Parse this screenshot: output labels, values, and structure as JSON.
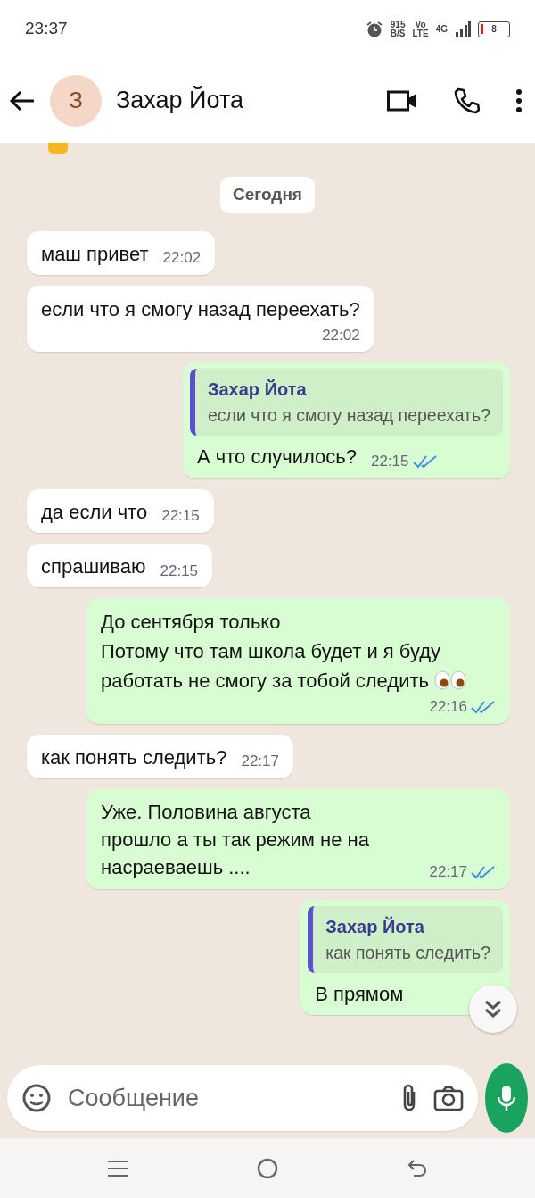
{
  "status_bar": {
    "time": "23:37",
    "speed": "915",
    "speed_unit": "B/S",
    "volte_top": "Vo",
    "volte_bottom": "LTE",
    "network": "4G",
    "battery": "8"
  },
  "header": {
    "avatar_letter": "З",
    "contact_name": "Захар Йота"
  },
  "date_chip": "Сегодня",
  "messages": [
    {
      "kind": "in",
      "text": "маш привет",
      "time": "22:02"
    },
    {
      "kind": "in",
      "text": "если что я смогу назад переехать?",
      "time": "22:02",
      "time_below": true
    },
    {
      "kind": "out",
      "quote": {
        "author": "Захар Йота",
        "text": "если что я смогу назад переехать?"
      },
      "text": "А что случилось?",
      "time": "22:15",
      "read": true
    },
    {
      "kind": "in",
      "text": "да если что",
      "time": "22:15"
    },
    {
      "kind": "in",
      "text": "спрашиваю",
      "time": "22:15"
    },
    {
      "kind": "out",
      "text": "До сентября только\nПотому что там школа будет и я буду работать  не смогу за тобой следить",
      "has_emoji": true,
      "time": "22:16",
      "read": true,
      "time_below": true
    },
    {
      "kind": "in",
      "text": "как понять следить?",
      "time": "22:17"
    },
    {
      "kind": "out",
      "text": "Уже. Половина августа\nпрошло а ты так режим не на насраеваешь ....",
      "time": "22:17",
      "read": true
    },
    {
      "kind": "out",
      "quote": {
        "author": "Захар Йота",
        "text": "как понять следить?"
      },
      "text": "В прямом"
    }
  ],
  "composer": {
    "placeholder": "Сообщение"
  }
}
